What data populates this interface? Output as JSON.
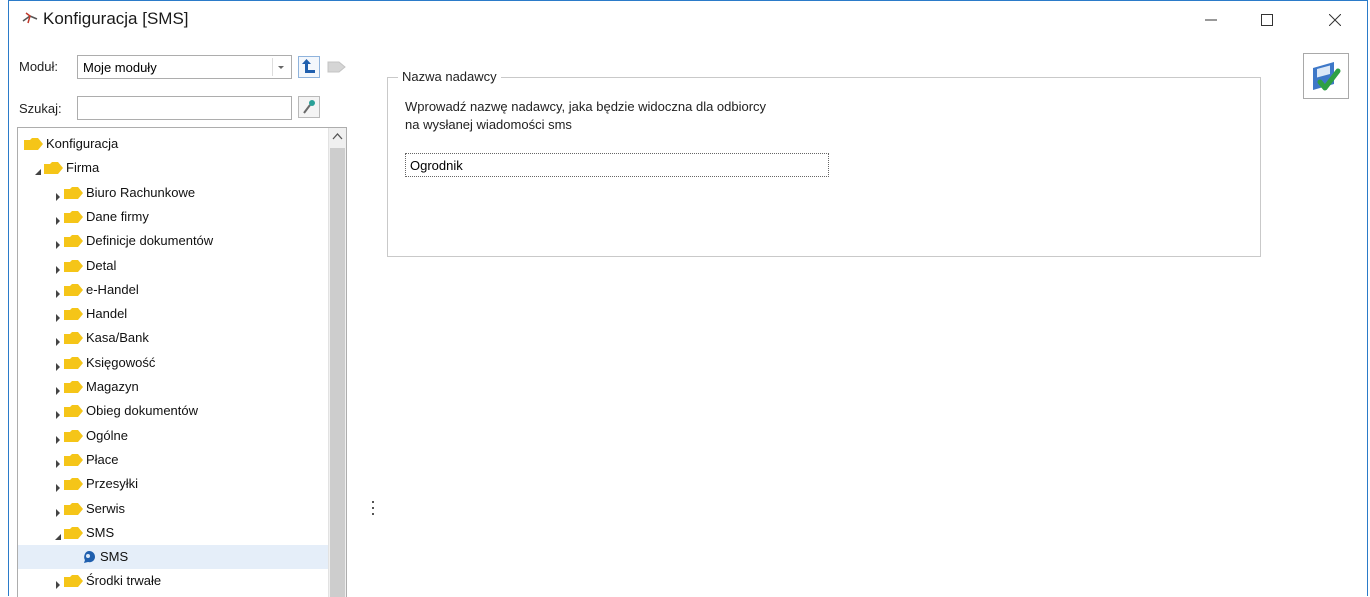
{
  "window": {
    "title": "Konfiguracja [SMS]"
  },
  "toolbar": {
    "module_label": "Moduł:",
    "module_value": "Moje moduły",
    "search_label": "Szukaj:",
    "search_value": ""
  },
  "tree": {
    "items": [
      {
        "label": "Konfiguracja"
      },
      {
        "label": "Firma"
      },
      {
        "label": "Biuro Rachunkowe"
      },
      {
        "label": "Dane firmy"
      },
      {
        "label": "Definicje dokumentów"
      },
      {
        "label": "Detal"
      },
      {
        "label": "e-Handel"
      },
      {
        "label": "Handel"
      },
      {
        "label": "Kasa/Bank"
      },
      {
        "label": "Księgowość"
      },
      {
        "label": "Magazyn"
      },
      {
        "label": "Obieg dokumentów"
      },
      {
        "label": "Ogólne"
      },
      {
        "label": "Płace"
      },
      {
        "label": "Przesyłki"
      },
      {
        "label": "Serwis"
      },
      {
        "label": "SMS"
      },
      {
        "label": "SMS"
      },
      {
        "label": "Środki trwałe"
      }
    ]
  },
  "panel": {
    "group_title": "Nazwa nadawcy",
    "description_line1": "Wprowadź nazwę nadawcy, jaka będzie widoczna dla odbiorcy",
    "description_line2": "na wysłanej wiadomości sms",
    "sender_name": "Ogrodnik"
  },
  "colors": {
    "accent": "#2b7bc9",
    "folder": "#f5c518",
    "selected_row": "#e5eef9",
    "save_check": "#2ea043"
  },
  "icons": [
    "title-icon",
    "minimize-icon",
    "maximize-icon",
    "close-icon",
    "chevron-down-icon",
    "back-arrow-icon",
    "forward-icon",
    "search-icon",
    "folder-icon",
    "sms-node-icon",
    "save-icon",
    "scroll-up-icon"
  ]
}
